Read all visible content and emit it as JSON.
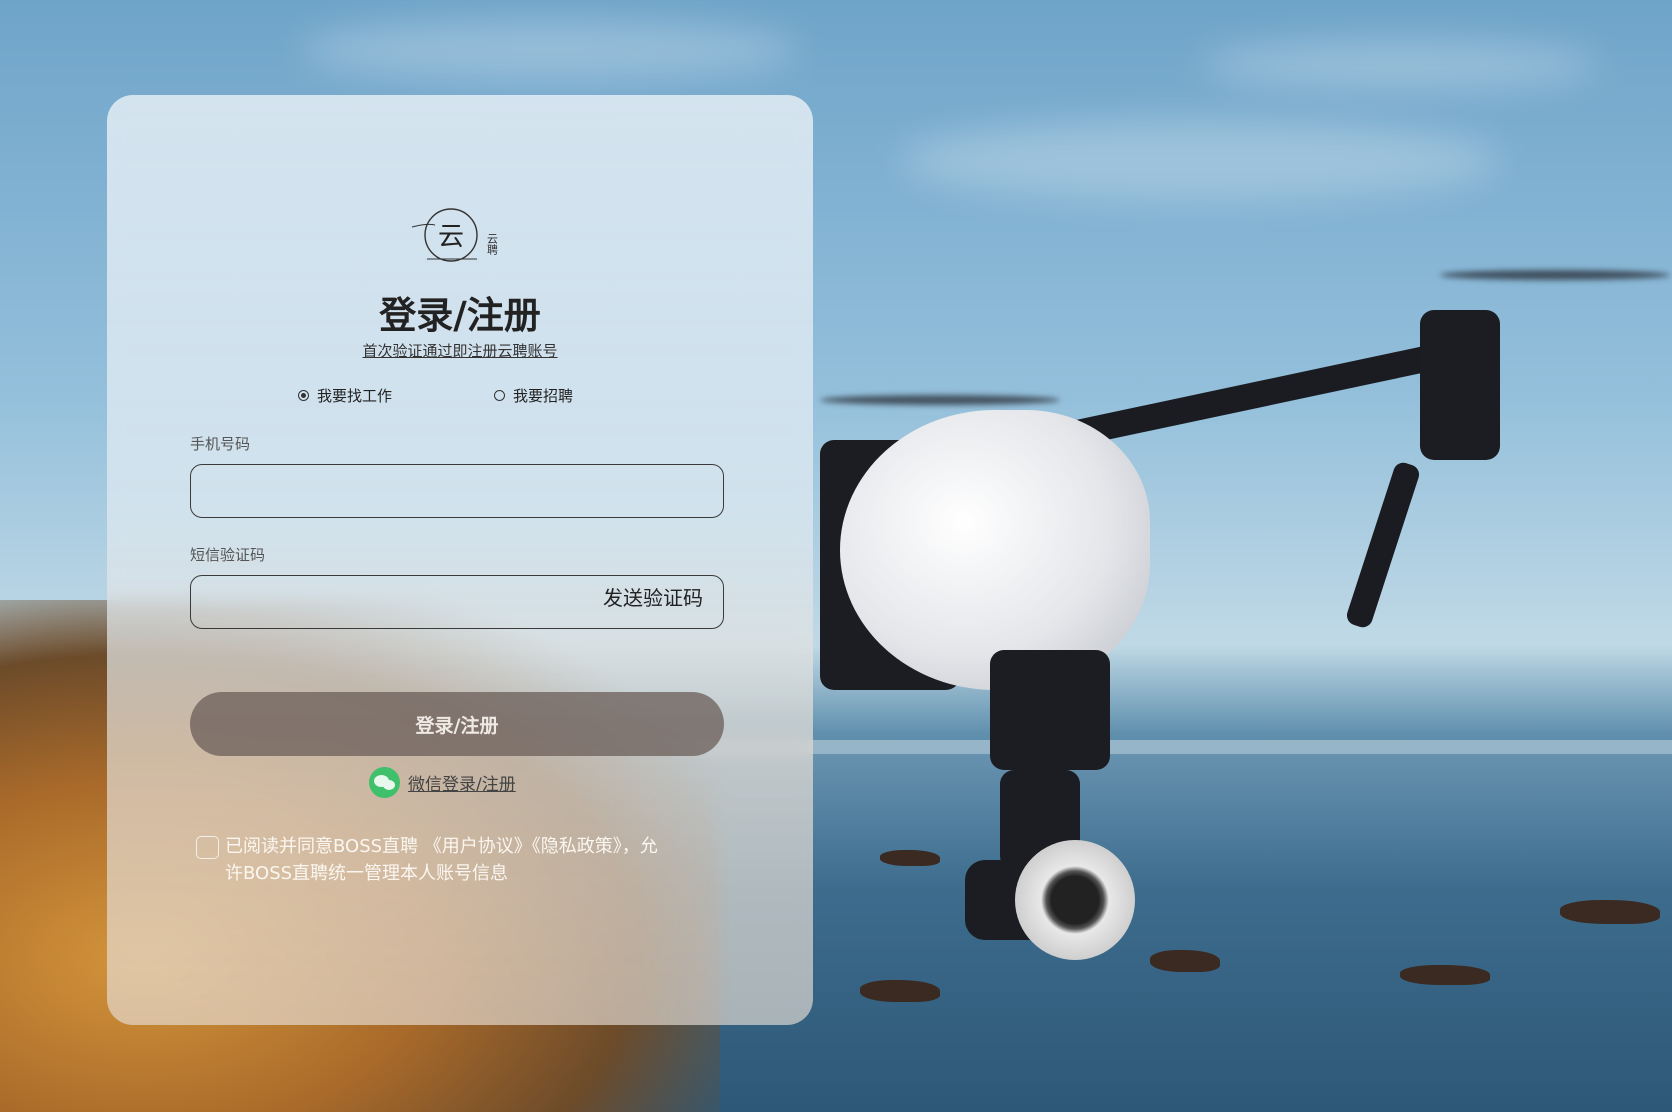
{
  "login": {
    "title": "登录/注册",
    "subtitle": "首次验证通过即注册云聘账号",
    "roles": [
      {
        "label": "我要找工作",
        "selected": true
      },
      {
        "label": "我要招聘",
        "selected": false
      }
    ],
    "phone_label": "手机号码",
    "phone_value": "",
    "sms_label": "短信验证码",
    "sms_value": "",
    "send_code": "发送验证码",
    "submit": "登录/注册",
    "wechat": "微信登录/注册",
    "agreement": "已阅读并同意BOSS直聘 《用户协议》《隐私政策》，允许BOSS直聘统一管理本人账号信息",
    "agreement_checked": false
  },
  "logo": {
    "glyph": "云",
    "side_text": "云聘"
  },
  "colors": {
    "title": "#222222",
    "submit_bg": "#6e625c",
    "wechat": "#3fc06a"
  }
}
